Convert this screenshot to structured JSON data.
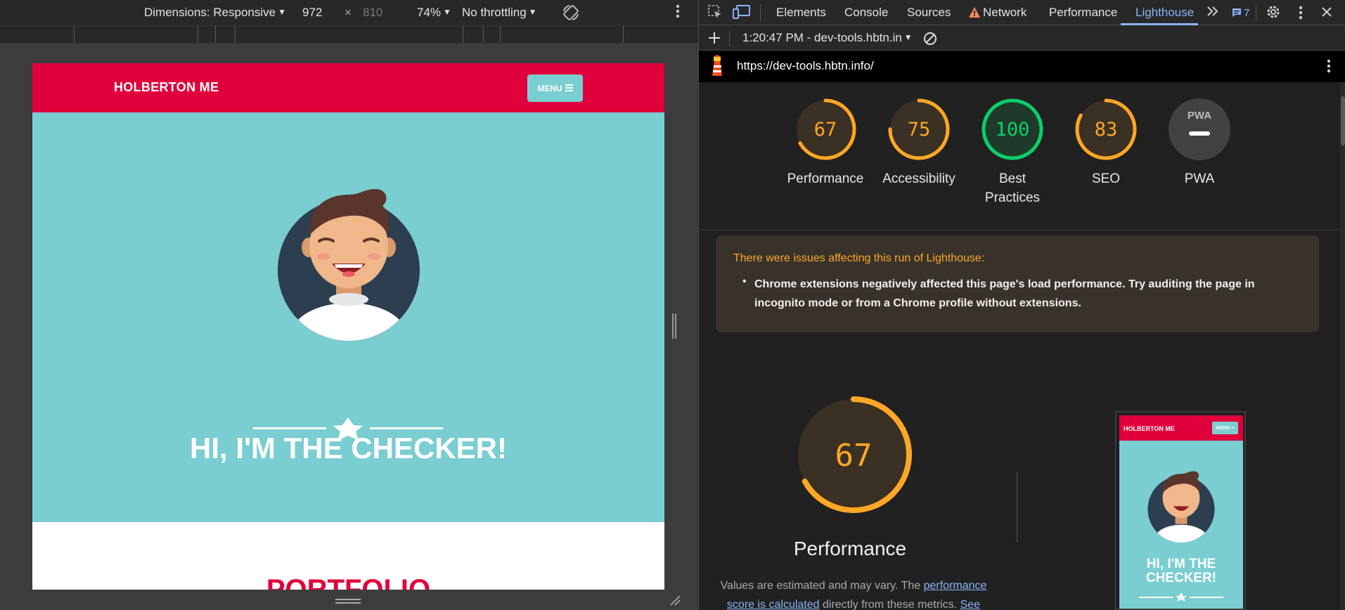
{
  "device_toolbar": {
    "dimensions_label": "Dimensions: Responsive",
    "width": "972",
    "times": "×",
    "height": "810",
    "zoom": "74%",
    "throttling": "No throttling"
  },
  "website": {
    "logo": "HOLBERTON ME",
    "menu_label": "MENU",
    "hero_title": "HI, I'M THE CHECKER!",
    "portfolio_title": "PORTFOLIO",
    "colors": {
      "brand_red": "#e0003c",
      "hero_teal": "#7acdd1"
    }
  },
  "devtools": {
    "tabs": [
      "Elements",
      "Console",
      "Sources",
      "Network",
      "Performance",
      "Lighthouse"
    ],
    "active_tab": "Lighthouse",
    "issues_count": "7",
    "report_selector": "1:20:47 PM - dev-tools.hbtn.in",
    "url": "https://dev-tools.hbtn.info/"
  },
  "lighthouse": {
    "scores": [
      {
        "label": "Performance",
        "score": 67,
        "display": "67",
        "status": "average"
      },
      {
        "label": "Accessibility",
        "score": 75,
        "display": "75",
        "status": "average"
      },
      {
        "label": "Best Practices",
        "score": 100,
        "display": "100",
        "status": "pass"
      },
      {
        "label": "SEO",
        "score": 83,
        "display": "83",
        "status": "average"
      },
      {
        "label": "PWA",
        "display": "PWA",
        "status": "na"
      }
    ],
    "colors": {
      "average": "#ffa726",
      "pass": "#0cce6b",
      "na": "#9e9e9e"
    },
    "warning": {
      "title": "There were issues affecting this run of Lighthouse:",
      "items": [
        "Chrome extensions negatively affected this page's load performance. Try auditing the page in incognito mode or from a Chrome profile without extensions."
      ]
    },
    "performance": {
      "score": 67,
      "display": "67",
      "title": "Performance",
      "desc_prefix": "Values are estimated and may vary. The ",
      "desc_link": "performance score is calculated",
      "desc_middle": " directly from these metrics. ",
      "desc_link2": "See"
    },
    "screenshot": {
      "logo": "HOLBERTON ME",
      "menu_label": "MENU",
      "title": "HI, I'M THE CHECKER!"
    }
  }
}
